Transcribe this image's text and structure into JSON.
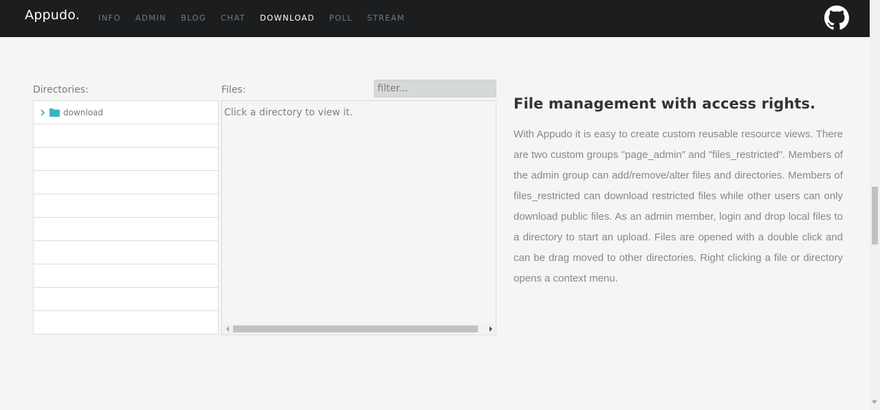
{
  "navbar": {
    "brand": "Appudo.",
    "items": [
      {
        "label": "INFO",
        "active": false
      },
      {
        "label": "ADMIN",
        "active": false
      },
      {
        "label": "BLOG",
        "active": false
      },
      {
        "label": "CHAT",
        "active": false
      },
      {
        "label": "DOWNLOAD",
        "active": true
      },
      {
        "label": "POLL",
        "active": false
      },
      {
        "label": "STREAM",
        "active": false
      }
    ],
    "github_icon": "github-icon"
  },
  "directories": {
    "label": "Directories:",
    "items": [
      {
        "name": "download",
        "icon": "folder-icon"
      }
    ]
  },
  "files": {
    "label": "Files:",
    "filter_placeholder": "filter...",
    "hint": "Click a directory to view it."
  },
  "description": {
    "title": "File management with access rights.",
    "body": "With Appudo it is easy to create custom reusable resource views. There are two custom groups \"page_admin\" and \"files_restricted\". Members of the admin group can add/remove/alter files and directories. Members of files_restricted can download restricted files while other users can only download public files. As an admin member, login and drop local files to a directory to start an upload. Files are opened with a double click and can be drag moved to other directories. Right clicking a file or directory opens a context menu."
  },
  "colors": {
    "navbar_bg": "#1b1d1f",
    "folder": "#3bb3c3",
    "page_bg": "#f5f5f5"
  }
}
